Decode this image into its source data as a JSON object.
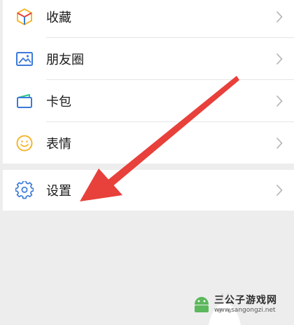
{
  "menu": {
    "items": [
      {
        "label": "收藏",
        "icon": "favorites-cube-icon"
      },
      {
        "label": "朋友圈",
        "icon": "moments-picture-icon"
      },
      {
        "label": "卡包",
        "icon": "card-wallet-icon"
      },
      {
        "label": "表情",
        "icon": "smiley-face-icon"
      }
    ],
    "settings": {
      "label": "设置",
      "icon": "gear-icon"
    }
  },
  "watermark": {
    "title": "三公子游戏网",
    "url": "www.sangongzi.net"
  },
  "colors": {
    "background": "#ededed",
    "row": "#ffffff",
    "arrow": "#e8403a",
    "icon_blue": "#3b7ad9",
    "icon_yellow": "#f5b72e",
    "icon_green": "#33c28a",
    "chevron": "#b2b2b2"
  }
}
